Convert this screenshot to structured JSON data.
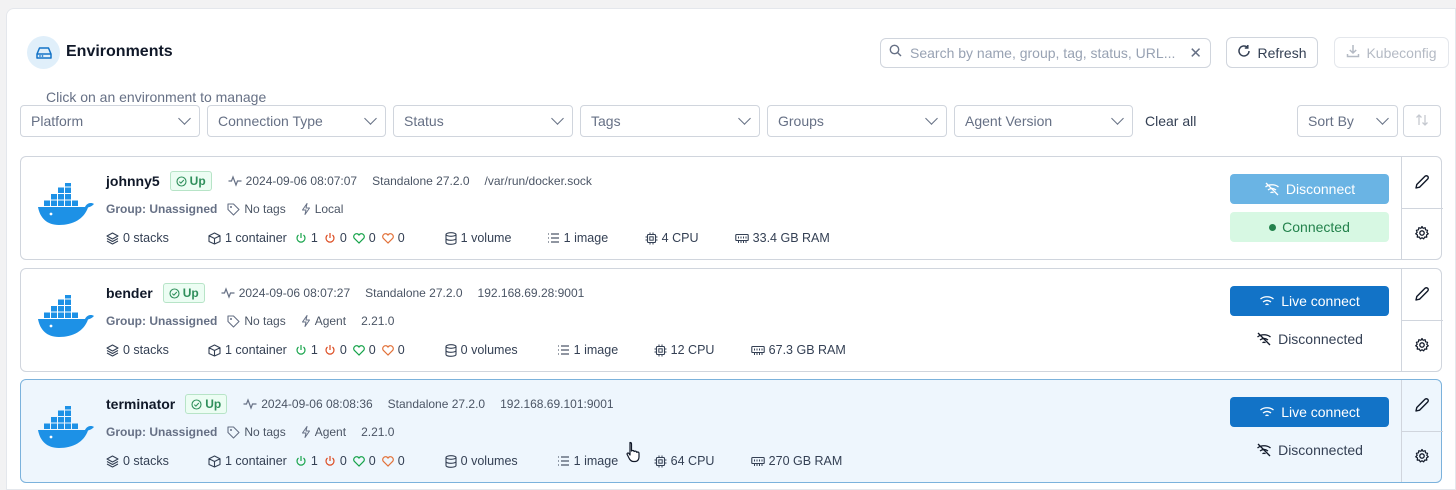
{
  "header": {
    "title": "Environments",
    "search_placeholder": "Search by name, group, tag, status, URL...",
    "refresh_label": "Refresh",
    "kubeconfig_label": "Kubeconfig",
    "hint": "Click on an environment to manage"
  },
  "filters": {
    "platform": "Platform",
    "connection_type": "Connection Type",
    "status": "Status",
    "tags": "Tags",
    "groups": "Groups",
    "agent_version": "Agent Version",
    "clear_all": "Clear all",
    "sort_by": "Sort By"
  },
  "environments": [
    {
      "name": "johnny5",
      "status": "Up",
      "heartbeat": "2024-09-06 08:07:07",
      "type": "Standalone 27.2.0",
      "url": "/var/run/docker.sock",
      "group": "Group: Unassigned",
      "tags": "No tags",
      "connection": "Local",
      "agent_version": "",
      "stacks": "0 stacks",
      "containers": "1 container",
      "running": "1",
      "stopped": "0",
      "healthy": "0",
      "unhealthy": "0",
      "volumes": "1 volume",
      "images": "1 image",
      "cpu": "4 CPU",
      "ram": "33.4 GB RAM",
      "primary_action": "Disconnect",
      "connection_state": "Connected"
    },
    {
      "name": "bender",
      "status": "Up",
      "heartbeat": "2024-09-06 08:07:27",
      "type": "Standalone 27.2.0",
      "url": "192.168.69.28:9001",
      "group": "Group: Unassigned",
      "tags": "No tags",
      "connection": "Agent",
      "agent_version": "2.21.0",
      "stacks": "0 stacks",
      "containers": "1 container",
      "running": "1",
      "stopped": "0",
      "healthy": "0",
      "unhealthy": "0",
      "volumes": "0 volumes",
      "images": "1 image",
      "cpu": "12 CPU",
      "ram": "67.3 GB RAM",
      "primary_action": "Live connect",
      "connection_state": "Disconnected"
    },
    {
      "name": "terminator",
      "status": "Up",
      "heartbeat": "2024-09-06 08:08:36",
      "type": "Standalone 27.2.0",
      "url": "192.168.69.101:9001",
      "group": "Group: Unassigned",
      "tags": "No tags",
      "connection": "Agent",
      "agent_version": "2.21.0",
      "stacks": "0 stacks",
      "containers": "1 container",
      "running": "1",
      "stopped": "0",
      "healthy": "0",
      "unhealthy": "0",
      "volumes": "0 volumes",
      "images": "1 image",
      "cpu": "64 CPU",
      "ram": "270 GB RAM",
      "primary_action": "Live connect",
      "connection_state": "Disconnected"
    }
  ],
  "colors": {
    "accent": "#1273c7",
    "docker_blue": "#1d91e6",
    "up_green": "#2f8f5b",
    "running_green": "#16a34a",
    "stopped_red": "#dc4a1f",
    "unhealthy_orange": "#e2723a",
    "selected_bg": "#eef6fd"
  }
}
